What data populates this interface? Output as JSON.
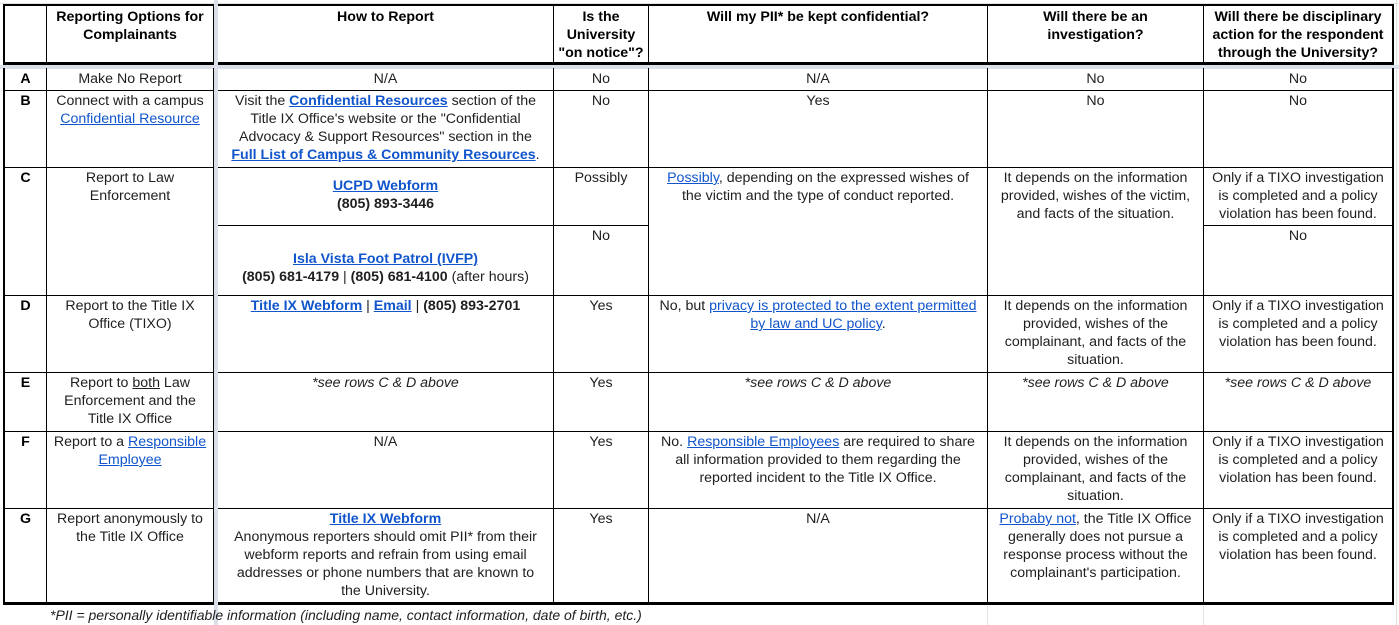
{
  "headers": {
    "col_letter": "",
    "col_option": "Reporting Options for Complainants",
    "col_how": "How to Report",
    "col_notice": "Is the University \"on notice\"?",
    "col_pii": "Will my PII* be kept confidential?",
    "col_investigation": "Will there be an investigation?",
    "col_discipline": "Will there be disciplinary action for the respondent through the University?"
  },
  "rows": {
    "A": {
      "letter": "A",
      "option": "Make No Report",
      "how": "N/A",
      "notice": "No",
      "pii": "N/A",
      "investigation": "No",
      "discipline": "No"
    },
    "B": {
      "letter": "B",
      "option_prefix": "Connect with a campus",
      "option_link": "Confidential Resource",
      "how_p1": "Visit the ",
      "how_link1": "Confidential Resources",
      "how_p2": " section of the Title IX Office's website or the \"Confidential Advocacy & Support Resources\" section in the ",
      "how_link2": "Full List of Campus & Community Resources",
      "how_p3": ".",
      "notice": "No",
      "pii": "Yes",
      "investigation": "No",
      "discipline": "No"
    },
    "C": {
      "letter": "C",
      "option": "Report to Law Enforcement",
      "how1_link": "UCPD Webform",
      "how1_phone": "(805) 893-3446",
      "how2_link": "Isla Vista Foot Patrol (IVFP)",
      "how2_phone1": "(805) 681-4179",
      "how2_sep": " | ",
      "how2_phone2": "(805) 681-4100",
      "how2_suffix": " (after hours)",
      "notice1": "Possibly",
      "notice2": "No",
      "pii_link": "Possibly",
      "pii_rest": ", depending on the expressed wishes of the victim and the type of conduct reported.",
      "investigation": "It depends on the information provided, wishes of the victim, and facts of the situation.",
      "discipline1": "Only if a TIXO investigation is completed and a policy violation has been found.",
      "discipline2": "No"
    },
    "D": {
      "letter": "D",
      "option": "Report to the Title IX Office (TIXO)",
      "how_link1": "Title IX Webform",
      "how_sep": " | ",
      "how_link2": "Email",
      "how_phone": "(805) 893-2701",
      "notice": "Yes",
      "pii_prefix": "No, but ",
      "pii_link": "privacy is protected to the extent permitted by law and UC policy",
      "pii_suffix": ".",
      "investigation": "It depends on the information provided, wishes of the complainant, and facts of the situation.",
      "discipline": "Only if a TIXO investigation is completed and a policy violation has been found."
    },
    "E": {
      "letter": "E",
      "option_p1": "Report to ",
      "option_u": "both",
      "option_p2": " Law Enforcement and the Title IX Office",
      "how": "*see rows C & D above",
      "notice": "Yes",
      "pii": "*see rows C & D above",
      "investigation": "*see rows C & D above",
      "discipline": "*see rows C & D above"
    },
    "F": {
      "letter": "F",
      "option_prefix": "Report to a ",
      "option_link": "Responsible Employee",
      "how": "N/A",
      "notice": "Yes",
      "pii_prefix": "No. ",
      "pii_link": "Responsible Employees",
      "pii_rest": " are required to share all information provided to them regarding the reported incident to the Title IX Office.",
      "investigation": "It depends on the information provided, wishes of the complainant, and facts of the situation.",
      "discipline": "Only if a TIXO investigation is completed and a policy violation has been found."
    },
    "G": {
      "letter": "G",
      "option": "Report anonymously to the Title IX Office",
      "how_link": "Title IX Webform",
      "how_rest": "Anonymous reporters should omit PII* from their webform reports and refrain from using email addresses or phone numbers that are known to the University.",
      "notice": "Yes",
      "pii": "N/A",
      "investigation_link": "Probaby not",
      "investigation_rest": ", the Title IX Office generally does not pursue a response process without the complainant's participation.",
      "discipline": "Only if a TIXO investigation is completed and a policy violation has been found."
    }
  },
  "footnote": "*PII = personally identifiable information (including name, contact information, date of birth, etc.)",
  "colors": {
    "link": "#1155cc",
    "freeze_divider": "#dadfe8",
    "border": "#000000"
  }
}
